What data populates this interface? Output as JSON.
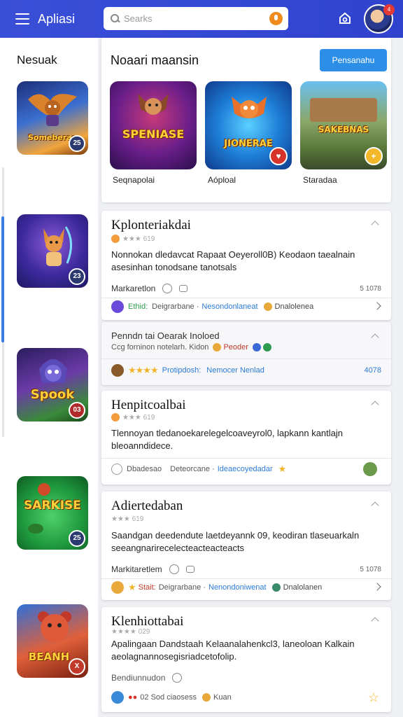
{
  "header": {
    "title": "Apliasi",
    "search_placeholder": "Searks",
    "notification_count": "4"
  },
  "sidebar": {
    "title": "Nesuak",
    "tiles": [
      {
        "label": "Someberae",
        "badge": "25"
      },
      {
        "label": "",
        "badge": "23"
      },
      {
        "label": "Spook",
        "badge": "03"
      },
      {
        "label": "SARKISE",
        "badge": "25"
      },
      {
        "label": "BEANH",
        "badge": "X"
      }
    ]
  },
  "featured": {
    "title": "Noaari maansin",
    "button_label": "Pensanahu",
    "cards": [
      {
        "art_text": "SPENIASE",
        "label": "Seqnapolai"
      },
      {
        "art_text": "JIONERAE",
        "label": "Aóploal"
      },
      {
        "art_text": "SAKEBNAS",
        "label": "Staradaa"
      }
    ]
  },
  "cards": [
    {
      "title": "Kplonteriakdai",
      "rating_text": "★★★ 619",
      "desc": "Nonnokan dledavcat Rapaat Oeyeroll0B) Keodaon taealnain asesinhan tonodsane tanotsals",
      "meta_label": "Markaretlon",
      "count": "5 1078",
      "footer": [
        "Ethid:",
        "Deigrarbane ·",
        "Nesondonlaneat",
        "Dnalolenea"
      ]
    },
    {
      "title": "Penndn tai Oearak Inoloed",
      "subtitle": "Ccg forninon notelarh. Kidon",
      "subtitle_tag": "Peoder",
      "footer": [
        "★★★★",
        "Protipdosh:",
        "Nemocer Nenlad"
      ],
      "count": "4078"
    },
    {
      "title": "Henpitcoalbai",
      "rating_text": "★★★ 619",
      "desc": "Tlennoyan tledanoekarelegelcoaveyrol0, lapkann kantlajn bleoanndidece.",
      "footer": [
        "Dbadesao",
        "Deteorcane ·",
        "Ideaecoyedadar"
      ]
    },
    {
      "title": "Adiertedaban",
      "rating_text": "★★★ 619",
      "desc": "Saandgan deedendute laetdeyannk 09, keodiran tlaseuarkaln seeangnarirecelecteacteacteacts",
      "meta_label": "Markitaretlem",
      "count": "5 1078",
      "footer": [
        "Stait:",
        "Deigrarbane ·",
        "Nenondoniwenat",
        "Dnalolanen"
      ]
    },
    {
      "title": "Klenhiottabai",
      "rating_text": "★★★★ 029",
      "desc": "Apalingaan Dandstaah Kelaanalahenkcl3, laneoloan Kalkain aeolagnannosegisriadcetofolip.",
      "meta_label": "Bendiunnudon",
      "footer": [
        "02 Sod ciaosess",
        "Kuan"
      ]
    }
  ],
  "colors": {
    "topbar": "#3a4fd8",
    "accent_button": "#2d8ee8",
    "star": "#f0b429",
    "link_blue": "#2b7bd6",
    "link_green": "#2e9b4f"
  }
}
